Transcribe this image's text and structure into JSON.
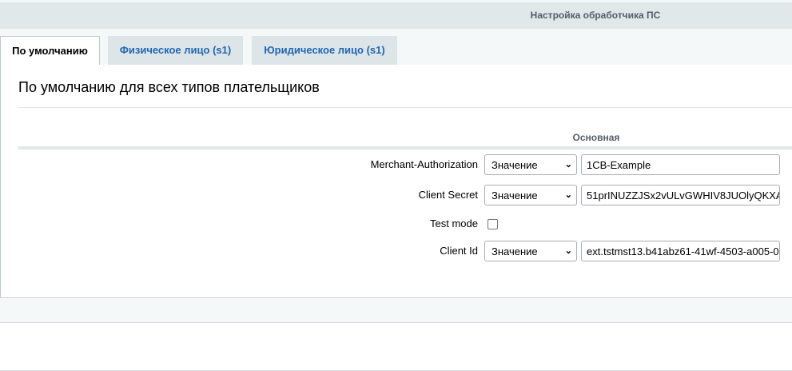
{
  "header": {
    "title": "Настройка обработчика ПС"
  },
  "tabs": [
    {
      "label": "По умолчанию",
      "active": true
    },
    {
      "label": "Физическое лицо (s1)",
      "active": false
    },
    {
      "label": "Юридическое лицо (s1)",
      "active": false
    }
  ],
  "panel": {
    "title": "По умолчанию для всех типов плательщиков",
    "section": "Основная",
    "fields": [
      {
        "label": "Merchant-Authorization",
        "type_select": "Значение",
        "value": "1CB-Example"
      },
      {
        "label": "Client Secret",
        "type_select": "Значение",
        "value": "51prINUZZJSx2vULvGWHIV8JUOlyQKXA"
      },
      {
        "label": "Test mode",
        "checked": false
      },
      {
        "label": "Client Id",
        "type_select": "Значение",
        "value": "ext.tstmst13.b41abz61-41wf-4503-a005-0"
      }
    ]
  },
  "colors": {
    "header_bg": "#e0e8ea",
    "tab_inactive_bg": "#dde5e8",
    "tab_link": "#2067b0"
  }
}
